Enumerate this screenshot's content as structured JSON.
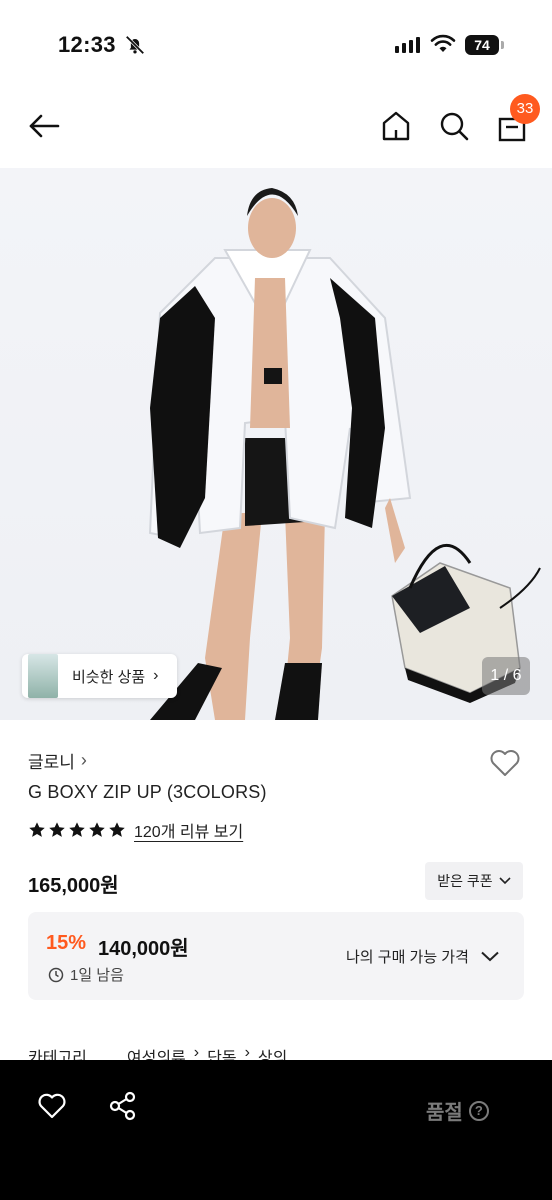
{
  "status_bar": {
    "time": "12:33",
    "battery": "74"
  },
  "nav": {
    "cart_count": "33"
  },
  "hero": {
    "similar_label": "비슷한 상품",
    "similar_chevron": "›",
    "page_indicator": "1 / 6"
  },
  "product": {
    "brand": "글로니",
    "brand_chevron": "›",
    "title": "G BOXY ZIP UP (3COLORS)",
    "rating_stars": 5,
    "reviews_label": "120개 리뷰 보기",
    "price": "165,000원",
    "coupon_label": "받은 쿠폰",
    "discount": {
      "percent": "15%",
      "price": "140,000원",
      "remaining": "1일 남음",
      "my_price_label": "나의 구매 가능 가격"
    },
    "category": {
      "label": "카테고리",
      "path": [
        "여성의류",
        "단독",
        "상의"
      ]
    }
  },
  "bottom_bar": {
    "soldout_label": "품절",
    "help_glyph": "?"
  },
  "colors": {
    "accent": "#ff5a1f",
    "bottom_bar": "#000000",
    "soldout_text": "#7b7b7b"
  },
  "icons": [
    "bell-off-icon",
    "signal-icon",
    "wifi-icon",
    "battery-icon",
    "back-arrow-icon",
    "home-icon",
    "search-icon",
    "shopping-bag-icon",
    "heart-icon",
    "star-icon",
    "clock-icon",
    "chevron-down-icon",
    "share-icon",
    "help-icon"
  ]
}
